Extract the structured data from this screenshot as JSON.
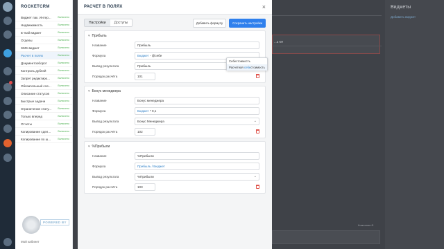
{
  "sidebar": {
    "title": "ROCKETCRM",
    "items": [
      {
        "name": "Виджет пак. Интер...",
        "status": "Включено"
      },
      {
        "name": "Недвижимость",
        "status": "Включено"
      },
      {
        "name": "E-mail виджет",
        "status": "Включено"
      },
      {
        "name": "Отделы",
        "status": "Включено"
      },
      {
        "name": "SMS-виджет",
        "status": "Включено"
      },
      {
        "name": "Расчет в полях",
        "status": "Включено"
      },
      {
        "name": "Документооборот",
        "status": "Включено"
      },
      {
        "name": "Контроль дублей",
        "status": "Включено"
      },
      {
        "name": "Запрет редактиро...",
        "status": "Включено"
      },
      {
        "name": "Обязательный сле...",
        "status": "Включено"
      },
      {
        "name": "Описание статусов",
        "status": "Включено"
      },
      {
        "name": "Быстрые задачи",
        "status": "Включено"
      },
      {
        "name": "Ограничение стату...",
        "status": "Включено"
      },
      {
        "name": "Только вперед",
        "status": "Включено"
      },
      {
        "name": "Отчеты",
        "status": "Включено"
      },
      {
        "name": "Копирование сдел...",
        "status": "Включено"
      },
      {
        "name": "Копирование по ш...",
        "status": "Включено"
      }
    ],
    "powered": "POWERED BY",
    "account": "Мой кабинет",
    "more": "..."
  },
  "background": {
    "widgets_title": "Виджеты",
    "add_widget": "Добавить виджет",
    "box_label": "...а КП",
    "small_text": "Компания Ф"
  },
  "modal": {
    "title": "РАСЧЕТ В ПОЛЯХ",
    "close": "×",
    "tabs": [
      "Настройки",
      "Доступы"
    ],
    "add_formula": "Добавить формулу",
    "save_settings": "Сохранить настройки",
    "sections": [
      {
        "header": "Прибыль",
        "name_label": "Название",
        "name_value": "Прибыль",
        "formula_label": "Формула",
        "formula_ref": "Бюджет",
        "formula_rest": " - @себе",
        "output_label": "Вывод результата",
        "output_value": "Прибыль",
        "order_label": "Порядок расчёта",
        "order_value": "101"
      },
      {
        "header": "Бонус менеджера",
        "name_label": "Название",
        "name_value": "Бонус менеджера",
        "formula_label": "Формула",
        "formula_ref": "Бюджет",
        "formula_rest": " * 0,1",
        "output_label": "Вывод результата",
        "output_value": "Бонус Менеджера",
        "order_label": "Порядок расчёта",
        "order_value": "102"
      },
      {
        "header": "%Прибыли",
        "name_label": "Название",
        "name_value": "%Прибыли",
        "formula_label": "Формула",
        "formula_ref": "Прибыль / Бюджет",
        "formula_rest": "",
        "output_label": "Вывод результата",
        "output_value": "%Прибыли",
        "order_label": "Порядок расчёта",
        "order_value": "103"
      }
    ],
    "dropdown": {
      "opt1": "Себестоимость",
      "opt2_a": "Расчетная ",
      "opt2_m": "себе",
      "opt2_b": "стоимость"
    }
  },
  "colors": {
    "accent": "#2f80ed",
    "enabled": "#4caf50",
    "delete": "#e0574f"
  }
}
